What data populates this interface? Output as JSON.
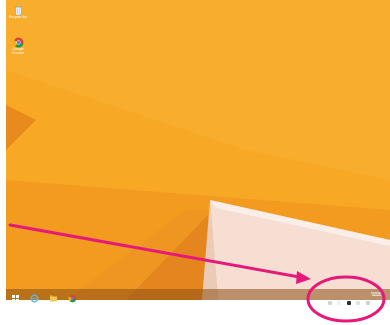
{
  "desktop": {
    "icons": [
      {
        "label": "Recycle Bin",
        "icon": "recycle-bin-icon"
      },
      {
        "label": "Google Chrome",
        "icon": "chrome-icon"
      }
    ]
  },
  "taskbar": {
    "items": [
      {
        "name": "start-button",
        "icon": "windows-logo-icon"
      },
      {
        "name": "internet-explorer-button",
        "icon": "internet-explorer-icon"
      },
      {
        "name": "file-explorer-button",
        "icon": "folder-icon"
      },
      {
        "name": "chrome-taskbar-button",
        "icon": "chrome-icon"
      }
    ]
  },
  "colors": {
    "wallpaper": "#f6a623",
    "highlight": "#e6197a"
  }
}
